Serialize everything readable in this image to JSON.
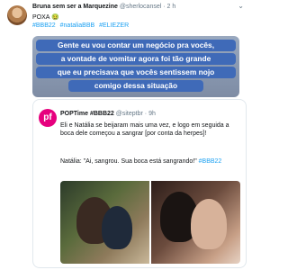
{
  "tweet": {
    "author_name": "Bruna sem ser a Marquezine",
    "handle": "@sherlocansel",
    "time": "2 h",
    "line1": "POXA 🤢",
    "hashtags": [
      "#BBB22",
      "#nataliaBBB",
      "#ELIEZER"
    ],
    "banner_lines": [
      "Gente eu vou contar um negócio pra vocês,",
      "a vontade de vomitar agora foi tão grande",
      "que eu precisava que vocês sentissem nojo",
      "comigo dessa situação"
    ]
  },
  "quoted": {
    "avatar_text": "pf",
    "name": "POPTime",
    "tag": "#BBB22",
    "handle": "@siteptbr",
    "time": "9h",
    "text": "Eli e Natália se beijaram mais uma vez, e logo em seguida a boca dele começou a sangrar [por conta da herpes]!",
    "text2": "Natália: \"Ai, sangrou. Sua boca está sangrando!\"",
    "text2_tag": "#BBB22"
  },
  "colors": {
    "link": "#1da1f2",
    "banner_pill": "#3f6ab8",
    "avatar_pink": "#e6007e"
  }
}
